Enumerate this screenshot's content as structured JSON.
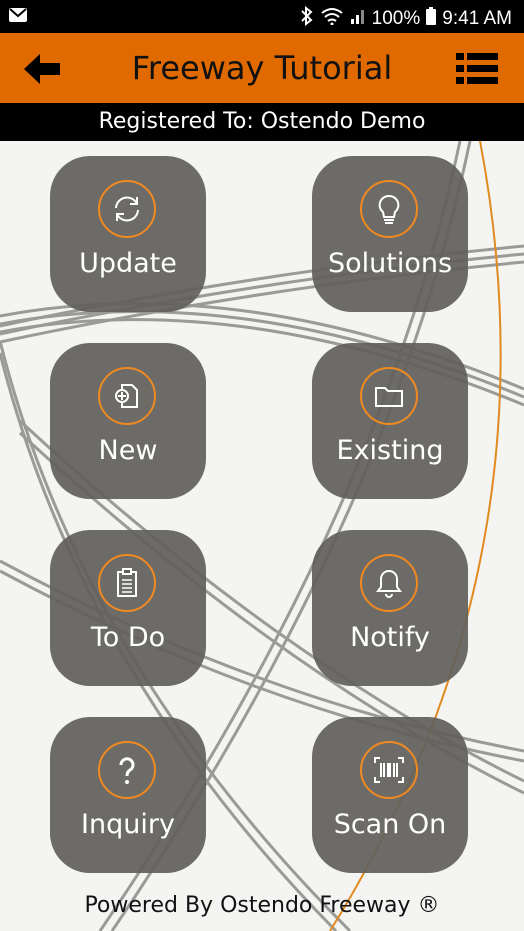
{
  "status": {
    "battery": "100%",
    "time": "9:41 AM"
  },
  "appbar": {
    "title": "Freeway Tutorial"
  },
  "registration": "Registered To: Ostendo Demo",
  "tiles": [
    {
      "label": "Update",
      "icon": "refresh-icon"
    },
    {
      "label": "Solutions",
      "icon": "lightbulb-icon"
    },
    {
      "label": "New",
      "icon": "new-document-icon"
    },
    {
      "label": "Existing",
      "icon": "folder-icon"
    },
    {
      "label": "To Do",
      "icon": "clipboard-icon"
    },
    {
      "label": "Notify",
      "icon": "bell-icon"
    },
    {
      "label": "Inquiry",
      "icon": "question-icon"
    },
    {
      "label": "Scan On",
      "icon": "barcode-icon"
    }
  ],
  "footer": "Powered By Ostendo Freeway ®",
  "colors": {
    "accent": "#e06a00",
    "tile": "#62605c",
    "icon_ring": "#f08a20"
  }
}
